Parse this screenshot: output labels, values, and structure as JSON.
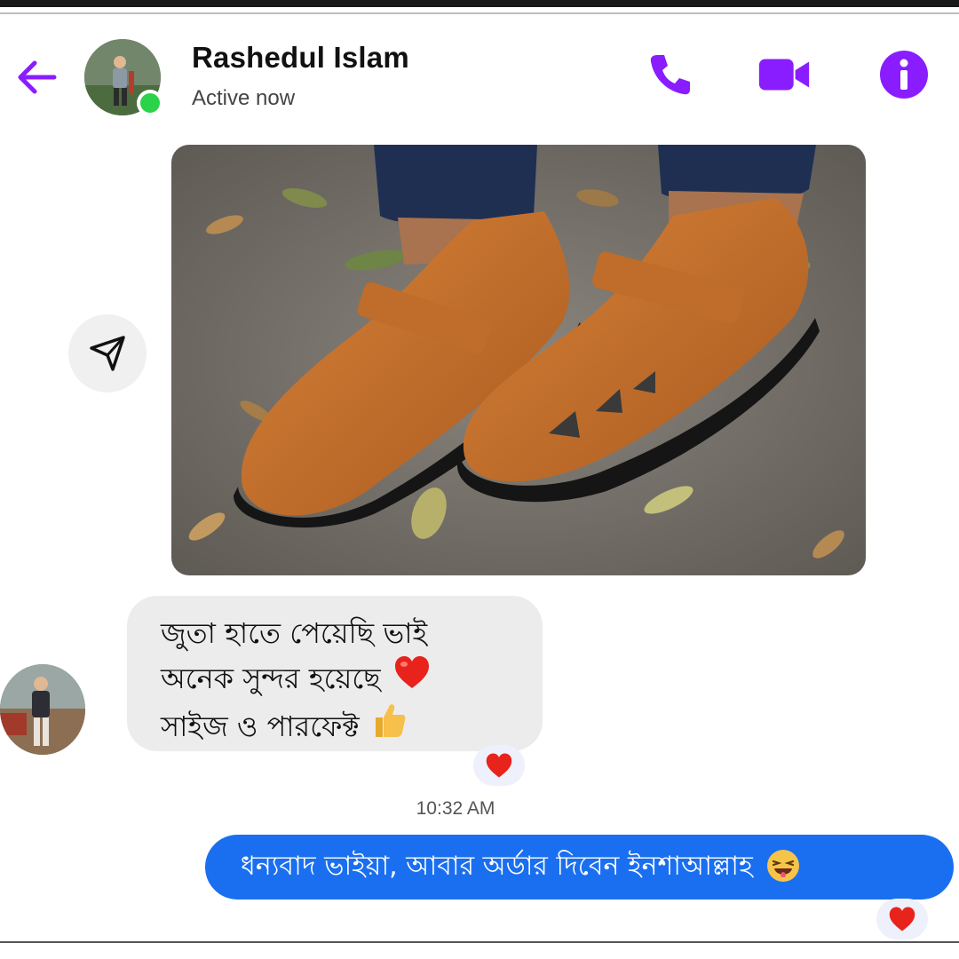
{
  "header": {
    "contact_name": "Rashedul Islam",
    "status": "Active now",
    "accent_color": "#8a1dff",
    "online_color": "#2bd34a",
    "icons": [
      "back-arrow-icon",
      "phone-icon",
      "video-camera-icon",
      "info-icon"
    ]
  },
  "thread": {
    "incoming_message": {
      "lines": [
        "জুতা হাতে পেয়েছি ভাই",
        "অনেক সুন্দর হয়েছে",
        "সাইজ ও পারফেক্ট"
      ],
      "emojis": [
        "heart",
        "thumbs-up"
      ],
      "reaction": "heart"
    },
    "timestamp": "10:32 AM",
    "outgoing_message": {
      "text": "ধন্যবাদ ভাইয়া, আবার অর্ডার দিবেন ইনশাআল্লাহ",
      "emoji": "grinning-squint-face",
      "reaction": "heart",
      "bubble_color": "#1a6ff0"
    }
  }
}
